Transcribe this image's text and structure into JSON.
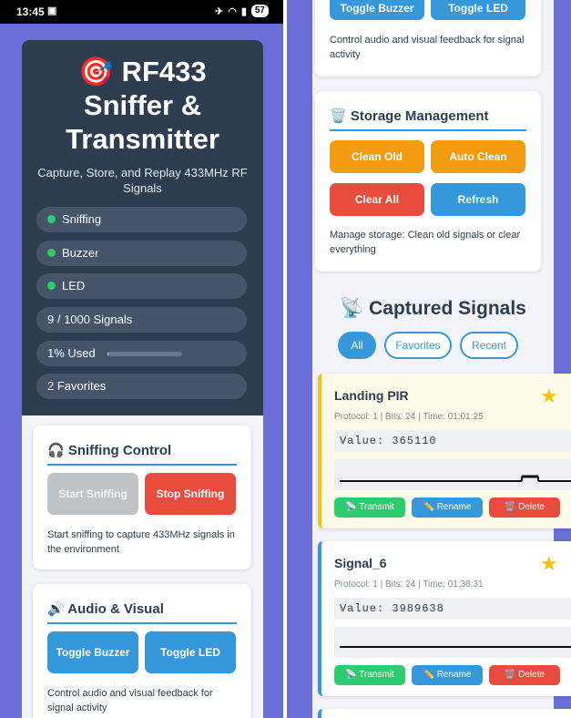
{
  "status_bar": {
    "time": "13:45",
    "battery": "57"
  },
  "header": {
    "title": "🎯 RF433 Sniffer & Transmitter",
    "subtitle": "Capture, Store, and Replay 433MHz RF Signals"
  },
  "status_pills": {
    "sniffing": "Sniffing",
    "buzzer": "Buzzer",
    "led": "LED",
    "signals": "9 / 1000 Signals",
    "used": "1% Used",
    "used_fraction": 0.01,
    "favorites": "2 Favorites"
  },
  "sniffing_control": {
    "title": "🎧 Sniffing Control",
    "start_label": "Start Sniffing",
    "stop_label": "Stop Sniffing",
    "description": "Start sniffing to capture 433MHz signals in the environment"
  },
  "audio_visual": {
    "title": "🔊 Audio & Visual",
    "toggle_buzzer": "Toggle Buzzer",
    "toggle_led": "Toggle LED",
    "description": "Control audio and visual feedback for signal activity"
  },
  "storage": {
    "title": "🗑️ Storage Management",
    "clean_old": "Clean Old",
    "auto_clean": "Auto Clean",
    "clear_all": "Clear All",
    "refresh": "Refresh",
    "description": "Manage storage: Clean old signals or clear everything"
  },
  "captured": {
    "title": "📡 Captured Signals",
    "filters": [
      "All",
      "Favorites",
      "Recent"
    ],
    "signals": [
      {
        "name": "Landing PIR",
        "meta": "Protocol: 1 | Bits: 24 | Time: 01:01:25",
        "value": "Value: 365110"
      },
      {
        "name": "Signal_6",
        "meta": "Protocol: 1 | Bits: 24 | Time: 01:36:31",
        "value": "Value: 3989638"
      }
    ],
    "actions": {
      "transmit": "📡 Transmit",
      "rename": "✏️ Rename",
      "delete": "🗑️ Delete"
    },
    "star_icon": "★"
  },
  "colors": {
    "primary": "#3498db",
    "danger": "#e74c3c",
    "success": "#2ecc71",
    "warning": "#f39c12",
    "hero": "#2e3c4f"
  }
}
